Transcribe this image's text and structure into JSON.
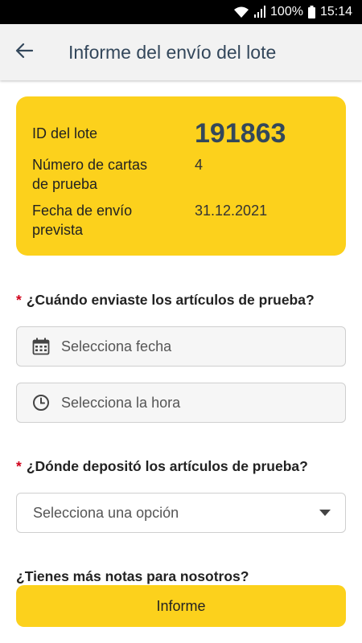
{
  "status_bar": {
    "battery": "100%",
    "time": "15:14",
    "icons": [
      "wifi-icon",
      "signal-icon",
      "battery-icon"
    ]
  },
  "header": {
    "title": "Informe del envío del lote",
    "back_icon": "arrow-left-icon"
  },
  "batch_info": {
    "id_label": "ID del lote",
    "id_value": "191863",
    "cards_label_line1": "Número de cartas",
    "cards_label_line2": "de prueba",
    "cards_value": "4",
    "date_label_line1": "Fecha de envío",
    "date_label_line2": "prevista",
    "date_value": "31.12.2021"
  },
  "when_question": {
    "required_mark": "*",
    "text": "¿Cuándo enviaste los artículos de prueba?",
    "date_placeholder": "Selecciona fecha",
    "date_icon": "calendar-icon",
    "time_placeholder": "Selecciona la hora",
    "time_icon": "clock-icon"
  },
  "where_question": {
    "required_mark": "*",
    "text": "¿Dónde depositó los artículos de prueba?",
    "select_placeholder": "Selecciona una opción",
    "select_icon": "caret-down-icon"
  },
  "notes_question": {
    "text": "¿Tienes más notas para nosotros?"
  },
  "submit": {
    "label": "Informe"
  },
  "colors": {
    "accent_yellow": "#fcd11c",
    "title_blue": "#33475b",
    "required_red": "#d0021b",
    "app_bar_bg": "#f2f2f2"
  }
}
